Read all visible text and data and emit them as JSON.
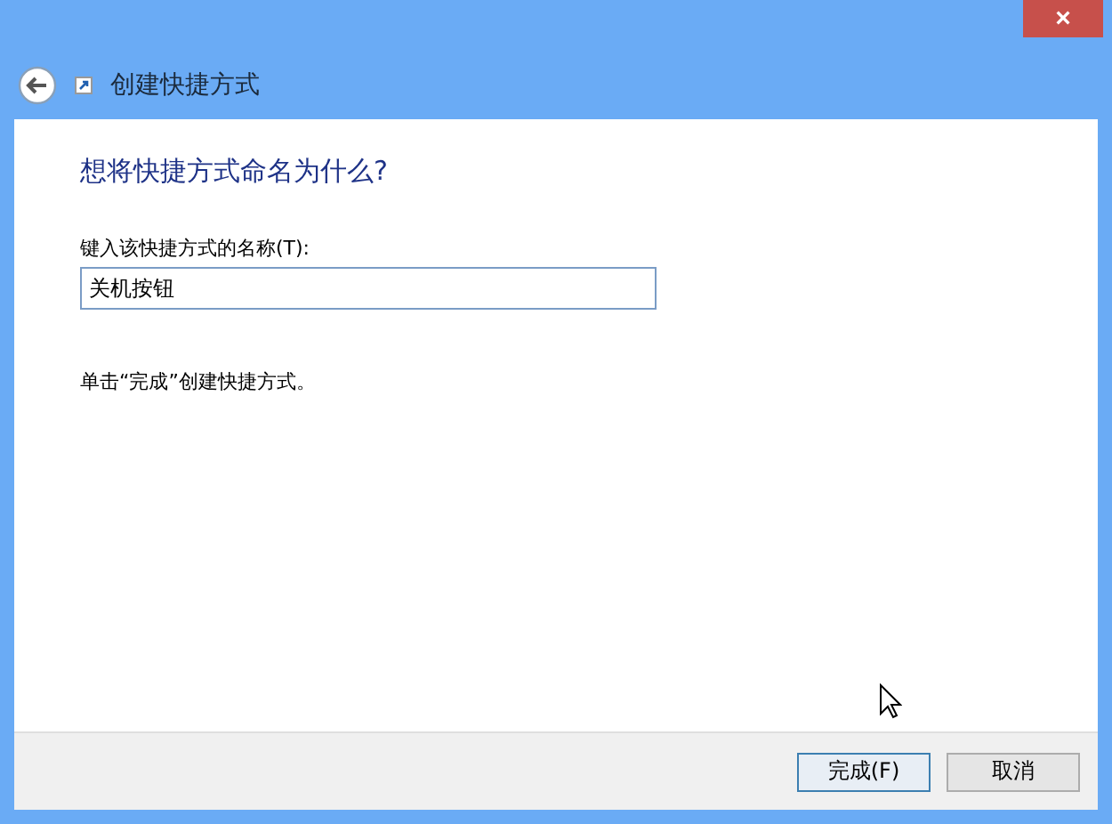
{
  "window": {
    "title": "创建快捷方式",
    "close": "×"
  },
  "heading": "想将快捷方式命名为什么?",
  "name_field": {
    "label": "键入该快捷方式的名称(T):",
    "value": "关机按钮"
  },
  "instruction": "单击“完成”创建快捷方式。",
  "buttons": [
    {
      "label": "完成(F)",
      "default": true
    },
    {
      "label": "取消",
      "default": false
    }
  ]
}
